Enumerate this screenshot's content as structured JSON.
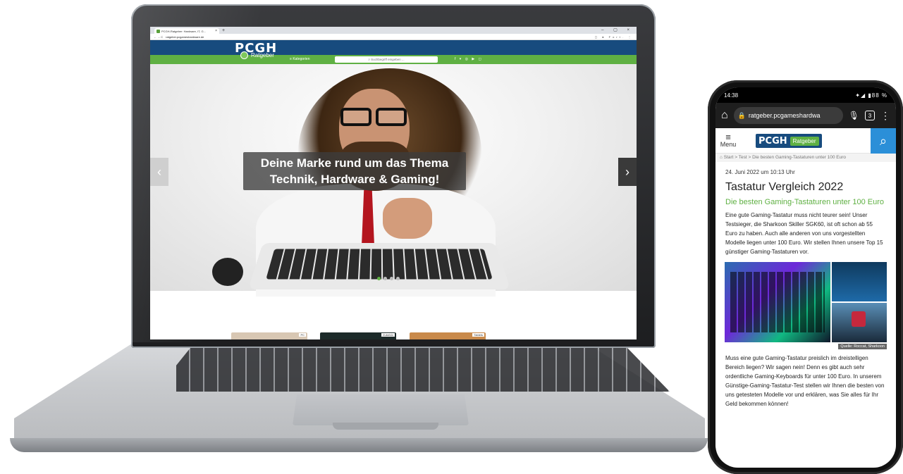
{
  "laptop": {
    "tab_title": "PCGH-Ratgeber: Hardware, IT, G...",
    "tab_close": "×",
    "new_tab": "+",
    "nav_buttons": "← → C",
    "url": "ratgeber.pcgameshardware.de",
    "addr_right": "◻ ● Fort. ⋮",
    "window_controls": "– ▢ ×",
    "site": {
      "logo": "PCGH",
      "logo_sub": "Ratgeber",
      "menu_label": "Kategorien",
      "search_placeholder": "Suchbegriff eingeben ...",
      "social_icons": "f ▾ ◎ ▶ ◻",
      "hero_caption_line1": "Deine Marke rund um das Thema",
      "hero_caption_line2": "Technik, Hardware & Gaming!",
      "arrow_left": "‹",
      "arrow_right": "›",
      "card_labels": [
        "PC",
        "Zubehör",
        "Tablets"
      ]
    }
  },
  "phone": {
    "status_time": "14:38",
    "status_right": "✦◢ ▮88 %",
    "url": "ratgeber.pcgameshardwa",
    "tab_count": "3",
    "menu_label": "Menu",
    "logo_text": "PCGH",
    "logo_badge": "Ratgeber",
    "breadcrumb": "⌂ Start  >  Test  >  Die besten Gaming-Tastaturen unter 100 Euro",
    "date": "24. Juni 2022 um 10:13 Uhr",
    "title": "Tastatur Vergleich 2022",
    "subtitle": "Die besten Gaming-Tastaturen unter 100 Euro",
    "paragraph1": "Eine gute Gaming-Tastatur muss nicht teurer sein! Unser Testsieger, die Sharkoon Skiller SGK60, ist oft schon ab 55 Euro zu haben. Auch alle anderen von uns vorgestellten Modelle liegen unter 100 Euro. Wir stellen Ihnen unsere Top 15 günstiger Gaming-Tastaturen vor.",
    "image_source": "Quelle: Roccat, Sharkoon",
    "paragraph2": "Muss eine gute Gaming-Tastatur preislich im dreistelligen Bereich liegen? Wir sagen nein! Denn es gibt auch sehr ordentliche Gaming-Keyboards für unter 100 Euro. In unserem Günstige-Gaming-Tastatur-Test stellen wir Ihnen die besten von uns getesteten Modelle vor und erklären, was Sie alles für Ihr Geld bekommen können!"
  },
  "colors": {
    "pcgh_blue": "#174b7e",
    "pcgh_green": "#5fb043",
    "search_blue": "#2b8fd8"
  }
}
